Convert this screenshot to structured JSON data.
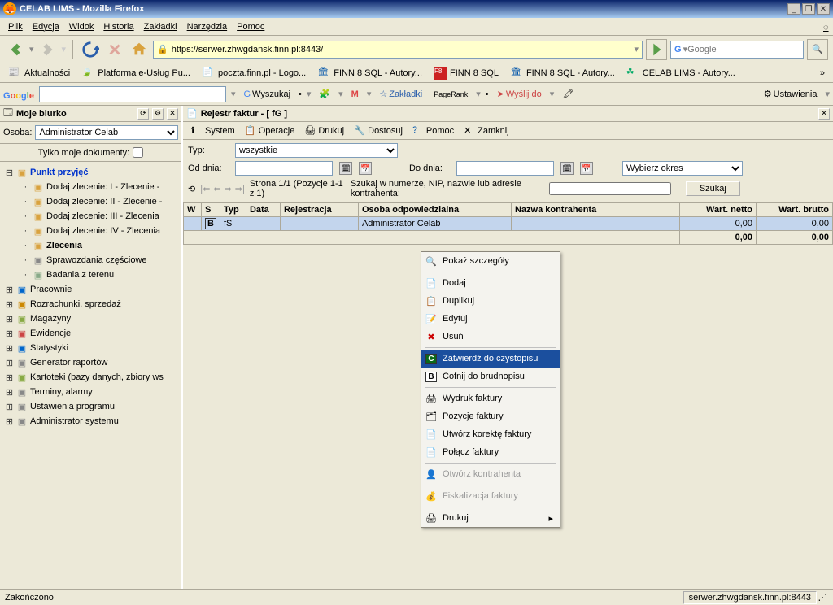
{
  "window": {
    "title": "CELAB LIMS - Mozilla Firefox"
  },
  "menu": {
    "plik": "Plik",
    "edycja": "Edycja",
    "widok": "Widok",
    "historia": "Historia",
    "zakladki": "Zakładki",
    "narzedzia": "Narzędzia",
    "pomoc": "Pomoc"
  },
  "url": "https://serwer.zhwgdansk.finn.pl:8443/",
  "search_placeholder": "Google",
  "bookmarks": [
    {
      "label": "Aktualności"
    },
    {
      "label": "Platforma e-Usług Pu..."
    },
    {
      "label": "poczta.finn.pl - Logo..."
    },
    {
      "label": "FINN 8 SQL - Autory..."
    },
    {
      "label": "FINN 8 SQL"
    },
    {
      "label": "FINN 8 SQL - Autory..."
    },
    {
      "label": "CELAB LIMS - Autory..."
    }
  ],
  "google_toolbar": {
    "wyszukaj": "Wyszukaj",
    "zakladki": "Zakładki",
    "pagerank": "PageRank",
    "wyslij": "Wyślij do",
    "ustawienia": "Ustawienia"
  },
  "sidebar": {
    "title": "Moje biurko",
    "osoba_label": "Osoba:",
    "osoba_value": "Administrator Celab",
    "tylko_moje": "Tylko moje dokumenty:",
    "tree": [
      {
        "indent": 0,
        "exp": "⊟",
        "bold": true,
        "label": "Punkt przyjęć",
        "color": "#0033cc"
      },
      {
        "indent": 1,
        "exp": "",
        "bold": false,
        "label": "Dodaj zlecenie: I - Zlecenie -"
      },
      {
        "indent": 1,
        "exp": "",
        "bold": false,
        "label": "Dodaj zlecenie: II - Zlecenie -"
      },
      {
        "indent": 1,
        "exp": "",
        "bold": false,
        "label": "Dodaj zlecenie: III - Zlecenia"
      },
      {
        "indent": 1,
        "exp": "",
        "bold": false,
        "label": "Dodaj zlecenie: IV - Zlecenia"
      },
      {
        "indent": 1,
        "exp": "",
        "bold": true,
        "label": "Zlecenia"
      },
      {
        "indent": 1,
        "exp": "",
        "bold": false,
        "label": "Sprawozdania częściowe"
      },
      {
        "indent": 1,
        "exp": "",
        "bold": false,
        "label": "Badania z terenu"
      },
      {
        "indent": 0,
        "exp": "⊞",
        "bold": false,
        "label": "Pracownie"
      },
      {
        "indent": 0,
        "exp": "⊞",
        "bold": false,
        "label": "Rozrachunki, sprzedaż"
      },
      {
        "indent": 0,
        "exp": "⊞",
        "bold": false,
        "label": "Magazyny"
      },
      {
        "indent": 0,
        "exp": "⊞",
        "bold": false,
        "label": "Ewidencje"
      },
      {
        "indent": 0,
        "exp": "⊞",
        "bold": false,
        "label": "Statystyki"
      },
      {
        "indent": 0,
        "exp": "⊞",
        "bold": false,
        "label": "Generator raportów"
      },
      {
        "indent": 0,
        "exp": "⊞",
        "bold": false,
        "label": "Kartoteki (bazy danych, zbiory ws"
      },
      {
        "indent": 0,
        "exp": "⊞",
        "bold": false,
        "label": "Terminy, alarmy"
      },
      {
        "indent": 0,
        "exp": "⊞",
        "bold": false,
        "label": "Ustawienia programu"
      },
      {
        "indent": 0,
        "exp": "⊞",
        "bold": false,
        "label": "Administrator systemu"
      }
    ]
  },
  "content": {
    "header": "Rejestr faktur - [ fG ]",
    "toolbar": {
      "system": "System",
      "operacje": "Operacje",
      "drukuj": "Drukuj",
      "dostosuj": "Dostosuj",
      "pomoc": "Pomoc",
      "zamknij": "Zamknij"
    },
    "filters": {
      "typ_label": "Typ:",
      "typ_value": "wszystkie",
      "od_dnia": "Od dnia:",
      "do_dnia": "Do dnia:",
      "okres": "Wybierz okres",
      "page_info": "Strona 1/1 (Pozycje 1-1 z 1)",
      "search_hint": "Szukaj w numerze, NIP, nazwie lub adresie kontrahenta:",
      "search_btn": "Szukaj"
    },
    "table": {
      "headers": [
        "W",
        "S",
        "Typ",
        "Data",
        "Rejestracja",
        "Osoba odpowiedzialna",
        "Nazwa kontrahenta",
        "Wart. netto",
        "Wart. brutto"
      ],
      "row": {
        "s": "B",
        "typ": "fS",
        "osoba": "Administrator Celab",
        "netto": "0,00",
        "brutto": "0,00"
      },
      "footer": {
        "netto": "0,00",
        "brutto": "0,00"
      }
    }
  },
  "context_menu": {
    "items": [
      {
        "label": "Pokaż szczegóły",
        "icon": "🔍"
      },
      {
        "sep": true
      },
      {
        "label": "Dodaj",
        "icon": "📄"
      },
      {
        "label": "Duplikuj",
        "icon": "📋"
      },
      {
        "label": "Edytuj",
        "icon": "📝"
      },
      {
        "label": "Usuń",
        "icon": "✖",
        "color": "#c00"
      },
      {
        "sep": true
      },
      {
        "label": "Zatwierdź do czystopisu",
        "sel": true,
        "icon": "C",
        "bgicon": "#0a6b1a"
      },
      {
        "label": "Cofnij do brudnopisu",
        "icon": "B",
        "bgicon": "#fff"
      },
      {
        "sep": true
      },
      {
        "label": "Wydruk faktury",
        "icon": "🖨"
      },
      {
        "label": "Pozycje faktury",
        "icon": "🗂"
      },
      {
        "label": "Utwórz korektę faktury",
        "icon": "📄"
      },
      {
        "label": "Połącz faktury",
        "icon": "📄"
      },
      {
        "sep": true
      },
      {
        "label": "Otwórz kontrahenta",
        "disabled": true,
        "icon": "👤"
      },
      {
        "sep": true
      },
      {
        "label": "Fiskalizacja faktury",
        "disabled": true,
        "icon": "💰"
      },
      {
        "sep": true
      },
      {
        "label": "Drukuj",
        "icon": "🖨",
        "arrow": true
      }
    ]
  },
  "status": {
    "left": "Zakończono",
    "right": "serwer.zhwgdansk.finn.pl:8443"
  }
}
